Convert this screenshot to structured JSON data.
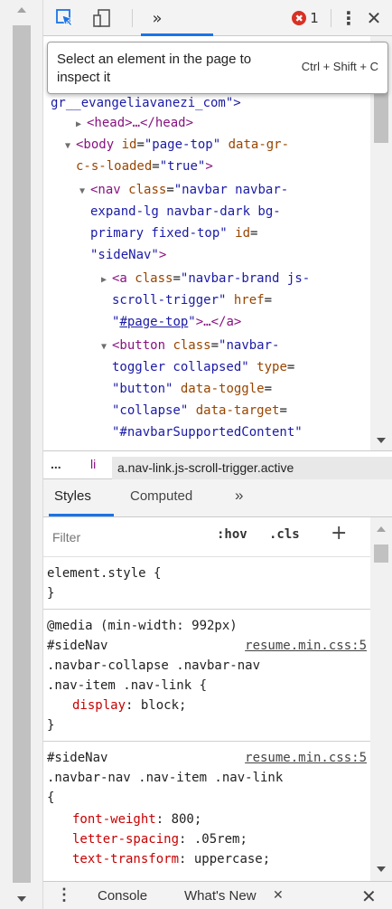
{
  "toolbar": {
    "more_tabs": "»",
    "error_count": "1",
    "error_icon": "✖",
    "kebab": "⋮",
    "close": "✕"
  },
  "tooltip": {
    "text": "Select an element in the page to inspect it",
    "shortcut": "Ctrl + Shift + C"
  },
  "elements": {
    "l0": "gr__evangeliavanezi_com\">",
    "head_tag": "<head>…</head>",
    "body_open": "<body ",
    "body_id_attr": "id",
    "body_id_val": "\"page-top\"",
    "body_gr_attr": "data-gr-",
    "body_gr_attr2": "c-s-loaded",
    "body_gr_val": "\"true\"",
    "nav_open": "<nav ",
    "nav_class_attr": "class",
    "nav_class_val1": "\"navbar navbar-",
    "nav_class_val2": "expand-lg navbar-dark bg-",
    "nav_class_val3": "primary fixed-top\"",
    "nav_id_attr": "id",
    "nav_id_val": "\"sideNav\"",
    "a_open": "<a ",
    "a_class_attr": "class",
    "a_class_val1": "\"navbar-brand js-",
    "a_class_val2": "scroll-trigger\"",
    "a_href_attr": "href",
    "a_href_link": "#page-top",
    "a_close": ">…</a>",
    "btn_open": "<button ",
    "btn_class_attr": "class",
    "btn_class_val1": "\"navbar-",
    "btn_class_val2": "toggler collapsed\"",
    "btn_type_attr": "type",
    "btn_type_val": "\"button\"",
    "btn_toggle_attr": "data-toggle",
    "btn_toggle_val": "\"collapse\"",
    "btn_target_attr": "data-target",
    "btn_target_val": "\"#navbarSupportedContent\""
  },
  "breadcrumb": {
    "ellipsis": "...",
    "li": "li",
    "active": "a.nav-link.js-scroll-trigger.active"
  },
  "styles_tabs": {
    "styles": "Styles",
    "computed": "Computed",
    "more": "»"
  },
  "filter": {
    "placeholder": "Filter",
    "hov": ":hov",
    "cls": ".cls",
    "add": "+"
  },
  "rules": {
    "element_style": "element.style {",
    "element_style_close": "}",
    "r1_media": "@media (min-width: 992px)",
    "r1_sel1": "#sideNav",
    "r1_src": "resume.min.css:5",
    "r1_sel2": ".navbar-collapse .navbar-nav",
    "r1_sel3": ".nav-item .nav-link {",
    "r1_p1_name": "display",
    "r1_p1_val": "block;",
    "r1_close": "}",
    "r2_sel1": "#sideNav",
    "r2_src": "resume.min.css:5",
    "r2_sel2": ".navbar-nav .nav-item .nav-link",
    "r2_open": "{",
    "r2_p1_name": "font-weight",
    "r2_p1_val": "800;",
    "r2_p2_name": "letter-spacing",
    "r2_p2_val": ".05rem;",
    "r2_p3_name": "text-transform",
    "r2_p3_val": "uppercase;"
  },
  "drawer": {
    "kebab": "⋮",
    "console": "Console",
    "whats_new": "What's New",
    "whats_new_close": "✕",
    "close": "✕"
  },
  "colors": {
    "accent": "#1a73e8",
    "error": "#d93025",
    "tag": "#881280",
    "attr": "#994500",
    "value": "#1a1aa6",
    "css_prop": "#c80000"
  }
}
